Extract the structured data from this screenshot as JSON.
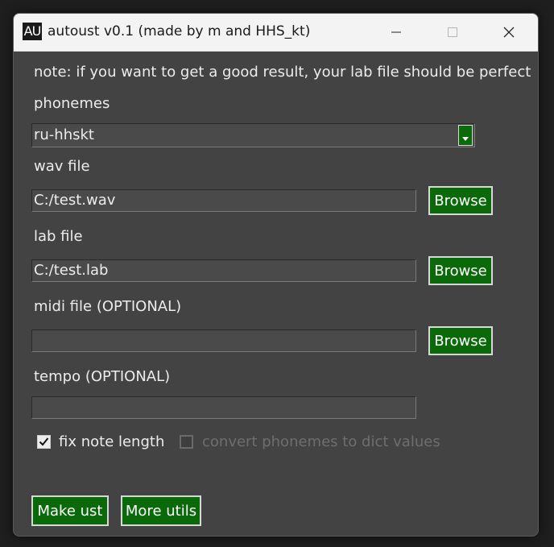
{
  "window": {
    "icon_text": "AU",
    "title": "autoust v0.1 (made by m and HHS_kt)"
  },
  "note": "note: if you want to get a good result, your lab file should be perfect",
  "phonemes": {
    "label": "phonemes",
    "selected": "ru-hhskt"
  },
  "wav": {
    "label": "wav file",
    "value": "C:/test.wav",
    "browse_label": "Browse"
  },
  "lab": {
    "label": "lab file",
    "value": "C:/test.lab",
    "browse_label": "Browse"
  },
  "midi": {
    "label": "midi file (OPTIONAL)",
    "value": "",
    "browse_label": "Browse"
  },
  "tempo": {
    "label": "tempo (OPTIONAL)",
    "value": ""
  },
  "options": {
    "fix_note_length": {
      "label": "fix note length",
      "checked": true
    },
    "convert_phonemes": {
      "label": "convert phonemes to dict values",
      "checked": false,
      "enabled": false
    }
  },
  "actions": {
    "make_ust": "Make ust",
    "more_utils": "More utils"
  },
  "colors": {
    "window_bg": "#434343",
    "button_green": "#0a6a0a",
    "text": "#ececec",
    "disabled_text": "#6e6e6e"
  }
}
